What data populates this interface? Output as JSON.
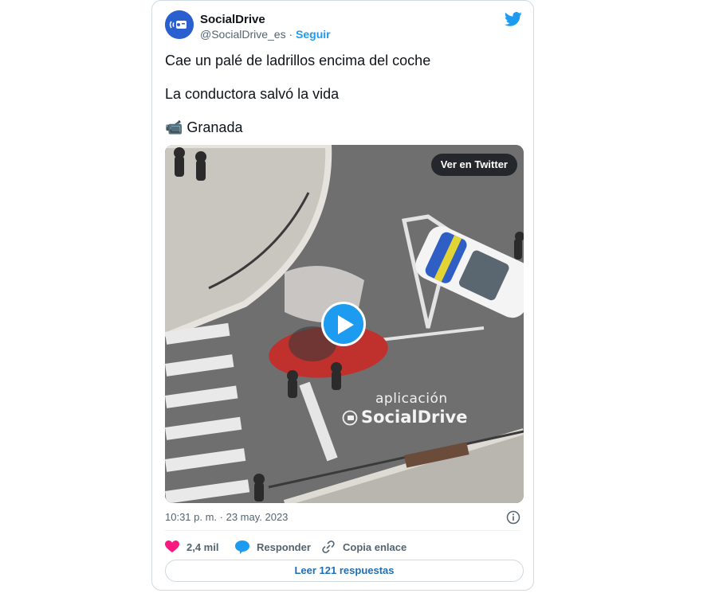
{
  "author": {
    "name": "SocialDrive",
    "handle": "@SocialDrive_es",
    "separator": "·",
    "follow_label": "Seguir"
  },
  "tweet": {
    "lines": [
      "Cae un palé de ladrillos encima del coche",
      "La conductora salvó la vida",
      "📹 Granada"
    ]
  },
  "media": {
    "view_on_twitter_label": "Ver en Twitter",
    "watermark_small": "aplicación",
    "watermark_big": "SocialDrive"
  },
  "meta": {
    "timestamp": "10:31 p. m. · 23 may. 2023"
  },
  "actions": {
    "likes_count": "2,4 mil",
    "reply_label": "Responder",
    "copy_link_label": "Copia enlace"
  },
  "replies_button_label": "Leer 121 respuestas",
  "colors": {
    "brand": "#1d9bf0",
    "like": "#f91880",
    "text": "#0f1419",
    "muted": "#536471",
    "border": "#cfd9de"
  },
  "icons": [
    "twitter-bird-icon",
    "play-icon",
    "info-icon",
    "heart-icon",
    "reply-bubble-icon",
    "link-icon"
  ]
}
